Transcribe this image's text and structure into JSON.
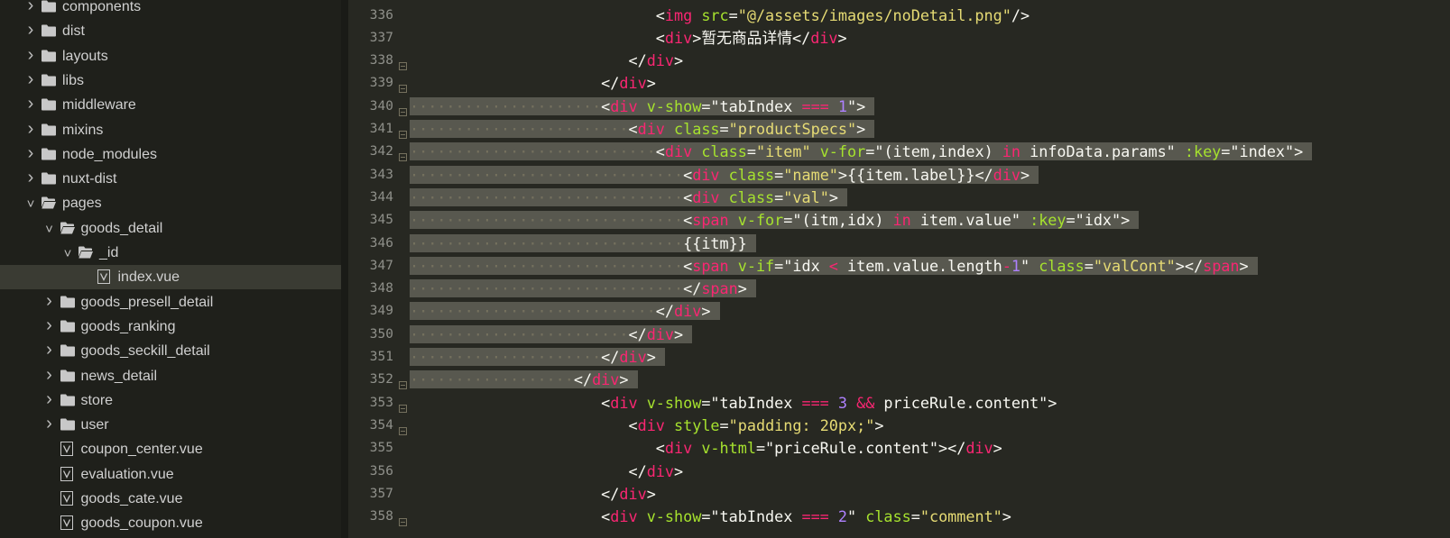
{
  "sidebar": {
    "items": [
      {
        "label": "components",
        "kind": "folder",
        "depth": 1,
        "expanded": false
      },
      {
        "label": "dist",
        "kind": "folder",
        "depth": 1,
        "expanded": false
      },
      {
        "label": "layouts",
        "kind": "folder",
        "depth": 1,
        "expanded": false
      },
      {
        "label": "libs",
        "kind": "folder",
        "depth": 1,
        "expanded": false
      },
      {
        "label": "middleware",
        "kind": "folder",
        "depth": 1,
        "expanded": false
      },
      {
        "label": "mixins",
        "kind": "folder",
        "depth": 1,
        "expanded": false
      },
      {
        "label": "node_modules",
        "kind": "folder",
        "depth": 1,
        "expanded": false
      },
      {
        "label": "nuxt-dist",
        "kind": "folder",
        "depth": 1,
        "expanded": false
      },
      {
        "label": "pages",
        "kind": "folder",
        "depth": 1,
        "expanded": true
      },
      {
        "label": "goods_detail",
        "kind": "folder",
        "depth": 2,
        "expanded": true
      },
      {
        "label": "_id",
        "kind": "folder",
        "depth": 3,
        "expanded": true
      },
      {
        "label": "index.vue",
        "kind": "file",
        "depth": 4,
        "selected": true
      },
      {
        "label": "goods_presell_detail",
        "kind": "folder",
        "depth": 2,
        "expanded": false
      },
      {
        "label": "goods_ranking",
        "kind": "folder",
        "depth": 2,
        "expanded": false
      },
      {
        "label": "goods_seckill_detail",
        "kind": "folder",
        "depth": 2,
        "expanded": false
      },
      {
        "label": "news_detail",
        "kind": "folder",
        "depth": 2,
        "expanded": false
      },
      {
        "label": "store",
        "kind": "folder",
        "depth": 2,
        "expanded": false
      },
      {
        "label": "user",
        "kind": "folder",
        "depth": 2,
        "expanded": false
      },
      {
        "label": "coupon_center.vue",
        "kind": "file",
        "depth": 2
      },
      {
        "label": "evaluation.vue",
        "kind": "file",
        "depth": 2
      },
      {
        "label": "goods_cate.vue",
        "kind": "file",
        "depth": 2
      },
      {
        "label": "goods_coupon.vue",
        "kind": "file",
        "depth": 2
      }
    ]
  },
  "editor": {
    "lines": [
      {
        "n": "336",
        "fold": false,
        "indent": 9,
        "hl": false,
        "tokens": [
          [
            "t",
            "<"
          ],
          [
            "tag",
            "img"
          ],
          [
            "t",
            " "
          ],
          [
            "attr",
            "src"
          ],
          [
            "t",
            "="
          ],
          [
            "str",
            "\"@/assets/images/noDetail.png\""
          ],
          [
            "t",
            "/>"
          ]
        ]
      },
      {
        "n": "337",
        "fold": false,
        "indent": 9,
        "hl": false,
        "tokens": [
          [
            "t",
            "<"
          ],
          [
            "tag",
            "div"
          ],
          [
            "t",
            ">暂无商品详情</"
          ],
          [
            "tag",
            "div"
          ],
          [
            "t",
            ">"
          ]
        ]
      },
      {
        "n": "338",
        "fold": true,
        "indent": 8,
        "hl": false,
        "tokens": [
          [
            "t",
            "</"
          ],
          [
            "tag",
            "div"
          ],
          [
            "t",
            ">"
          ]
        ]
      },
      {
        "n": "339",
        "fold": true,
        "indent": 7,
        "hl": false,
        "tokens": [
          [
            "t",
            "</"
          ],
          [
            "tag",
            "div"
          ],
          [
            "t",
            ">"
          ]
        ]
      },
      {
        "n": "340",
        "fold": true,
        "indent": 7,
        "hl": true,
        "tokens": [
          [
            "t",
            "<"
          ],
          [
            "tag",
            "div"
          ],
          [
            "t",
            " "
          ],
          [
            "attr",
            "v-show"
          ],
          [
            "t",
            "=\"tabIndex "
          ],
          [
            "op",
            "==="
          ],
          [
            "t",
            " "
          ],
          [
            "num",
            "1"
          ],
          [
            "t",
            "\">"
          ]
        ]
      },
      {
        "n": "341",
        "fold": true,
        "indent": 8,
        "hl": true,
        "tokens": [
          [
            "t",
            "<"
          ],
          [
            "tag",
            "div"
          ],
          [
            "t",
            " "
          ],
          [
            "attr",
            "class"
          ],
          [
            "t",
            "="
          ],
          [
            "str",
            "\"productSpecs\""
          ],
          [
            "t",
            ">"
          ]
        ]
      },
      {
        "n": "342",
        "fold": true,
        "indent": 9,
        "hl": true,
        "tokens": [
          [
            "t",
            "<"
          ],
          [
            "tag",
            "div"
          ],
          [
            "t",
            " "
          ],
          [
            "attr",
            "class"
          ],
          [
            "t",
            "="
          ],
          [
            "str",
            "\"item\""
          ],
          [
            "t",
            " "
          ],
          [
            "attr",
            "v-for"
          ],
          [
            "t",
            "=\"(item,index) "
          ],
          [
            "op",
            "in"
          ],
          [
            "t",
            " infoData.params\" "
          ],
          [
            "attr",
            ":key"
          ],
          [
            "t",
            "=\"index\">"
          ]
        ]
      },
      {
        "n": "343",
        "fold": false,
        "indent": 10,
        "hl": true,
        "tokens": [
          [
            "t",
            "<"
          ],
          [
            "tag",
            "div"
          ],
          [
            "t",
            " "
          ],
          [
            "attr",
            "class"
          ],
          [
            "t",
            "="
          ],
          [
            "str",
            "\"name\""
          ],
          [
            "t",
            ">{{item.label}}</"
          ],
          [
            "tag",
            "div"
          ],
          [
            "t",
            ">"
          ]
        ]
      },
      {
        "n": "344",
        "fold": false,
        "indent": 10,
        "hl": true,
        "tokens": [
          [
            "t",
            "<"
          ],
          [
            "tag",
            "div"
          ],
          [
            "t",
            " "
          ],
          [
            "attr",
            "class"
          ],
          [
            "t",
            "="
          ],
          [
            "str",
            "\"val\""
          ],
          [
            "t",
            ">"
          ]
        ]
      },
      {
        "n": "345",
        "fold": false,
        "indent": 10,
        "hl": true,
        "tokens": [
          [
            "t",
            "<"
          ],
          [
            "tag",
            "span"
          ],
          [
            "t",
            " "
          ],
          [
            "attr",
            "v-for"
          ],
          [
            "t",
            "=\"(itm,idx) "
          ],
          [
            "op",
            "in"
          ],
          [
            "t",
            " item.value\" "
          ],
          [
            "attr",
            ":key"
          ],
          [
            "t",
            "=\"idx\">"
          ]
        ]
      },
      {
        "n": "346",
        "fold": false,
        "indent": 10,
        "hl": true,
        "tokens": [
          [
            "t",
            "{{itm}}"
          ]
        ]
      },
      {
        "n": "347",
        "fold": false,
        "indent": 10,
        "hl": true,
        "tokens": [
          [
            "t",
            "<"
          ],
          [
            "tag",
            "span"
          ],
          [
            "t",
            " "
          ],
          [
            "attr",
            "v-if"
          ],
          [
            "t",
            "=\"idx "
          ],
          [
            "op",
            "<"
          ],
          [
            "t",
            " item.value.length"
          ],
          [
            "op",
            "-"
          ],
          [
            "num",
            "1"
          ],
          [
            "t",
            "\" "
          ],
          [
            "attr",
            "class"
          ],
          [
            "t",
            "="
          ],
          [
            "str",
            "\"valCont\""
          ],
          [
            "t",
            "></"
          ],
          [
            "tag",
            "span"
          ],
          [
            "t",
            ">"
          ]
        ]
      },
      {
        "n": "348",
        "fold": false,
        "indent": 10,
        "hl": true,
        "tokens": [
          [
            "t",
            "</"
          ],
          [
            "tag",
            "span"
          ],
          [
            "t",
            ">"
          ]
        ]
      },
      {
        "n": "349",
        "fold": false,
        "indent": 9,
        "hl": true,
        "tokens": [
          [
            "t",
            "</"
          ],
          [
            "tag",
            "div"
          ],
          [
            "t",
            ">"
          ]
        ]
      },
      {
        "n": "350",
        "fold": false,
        "indent": 8,
        "hl": true,
        "tokens": [
          [
            "t",
            "</"
          ],
          [
            "tag",
            "div"
          ],
          [
            "t",
            ">"
          ]
        ]
      },
      {
        "n": "351",
        "fold": false,
        "indent": 7,
        "hl": true,
        "tokens": [
          [
            "t",
            "</"
          ],
          [
            "tag",
            "div"
          ],
          [
            "t",
            ">"
          ]
        ]
      },
      {
        "n": "352",
        "fold": true,
        "indent": 6,
        "hl": true,
        "tokens": [
          [
            "t",
            "</"
          ],
          [
            "tag",
            "div"
          ],
          [
            "t",
            ">"
          ]
        ]
      },
      {
        "n": "353",
        "fold": true,
        "indent": 7,
        "hl": false,
        "tokens": [
          [
            "t",
            "<"
          ],
          [
            "tag",
            "div"
          ],
          [
            "t",
            " "
          ],
          [
            "attr",
            "v-show"
          ],
          [
            "t",
            "=\"tabIndex "
          ],
          [
            "op",
            "==="
          ],
          [
            "t",
            " "
          ],
          [
            "num",
            "3"
          ],
          [
            "t",
            " "
          ],
          [
            "op",
            "&&"
          ],
          [
            "t",
            " priceRule.content\">"
          ]
        ]
      },
      {
        "n": "354",
        "fold": true,
        "indent": 8,
        "hl": false,
        "tokens": [
          [
            "t",
            "<"
          ],
          [
            "tag",
            "div"
          ],
          [
            "t",
            " "
          ],
          [
            "attr",
            "style"
          ],
          [
            "t",
            "="
          ],
          [
            "str",
            "\"padding: 20px;\""
          ],
          [
            "t",
            ">"
          ]
        ]
      },
      {
        "n": "355",
        "fold": false,
        "indent": 9,
        "hl": false,
        "tokens": [
          [
            "t",
            "<"
          ],
          [
            "tag",
            "div"
          ],
          [
            "t",
            " "
          ],
          [
            "attr",
            "v-html"
          ],
          [
            "t",
            "=\"priceRule.content\"></"
          ],
          [
            "tag",
            "div"
          ],
          [
            "t",
            ">"
          ]
        ]
      },
      {
        "n": "356",
        "fold": false,
        "indent": 8,
        "hl": false,
        "tokens": [
          [
            "t",
            "</"
          ],
          [
            "tag",
            "div"
          ],
          [
            "t",
            ">"
          ]
        ]
      },
      {
        "n": "357",
        "fold": false,
        "indent": 7,
        "hl": false,
        "tokens": [
          [
            "t",
            "</"
          ],
          [
            "tag",
            "div"
          ],
          [
            "t",
            ">"
          ]
        ]
      },
      {
        "n": "358",
        "fold": true,
        "indent": 7,
        "hl": false,
        "tokens": [
          [
            "t",
            "<"
          ],
          [
            "tag",
            "div"
          ],
          [
            "t",
            " "
          ],
          [
            "attr",
            "v-show"
          ],
          [
            "t",
            "=\"tabIndex "
          ],
          [
            "op",
            "==="
          ],
          [
            "t",
            " "
          ],
          [
            "num",
            "2"
          ],
          [
            "t",
            "\" "
          ],
          [
            "attr",
            "class"
          ],
          [
            "t",
            "="
          ],
          [
            "str",
            "\"comment\""
          ],
          [
            "t",
            ">"
          ]
        ]
      }
    ]
  },
  "colors": {
    "background": "#272822",
    "sidebar": "#1f201b",
    "tag": "#f92672",
    "attribute": "#a6e22e",
    "string": "#e6db74",
    "number": "#ae81ff",
    "selection": "#58584f"
  }
}
